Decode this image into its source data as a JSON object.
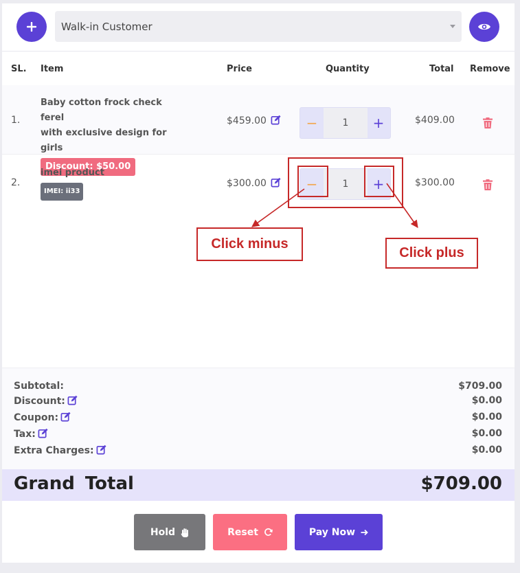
{
  "customer": {
    "selected": "Walk-in Customer",
    "add_icon": "plus-icon",
    "view_icon": "eye-icon"
  },
  "table": {
    "headers": {
      "sl": "SL.",
      "item": "Item",
      "price": "Price",
      "quantity": "Quantity",
      "total": "Total",
      "remove": "Remove"
    },
    "rows": [
      {
        "sl": "1.",
        "name_line1": "Baby cotton frock check ferel",
        "name_line2": "with exclusive design for girls",
        "badge": "Discount: $50.00",
        "price": "$459.00",
        "qty_minus": "−",
        "qty": "1",
        "qty_plus": "+",
        "total": "$409.00"
      },
      {
        "sl": "2.",
        "name_line1": "imei product",
        "badge": "IMEI: ii33",
        "price": "$300.00",
        "qty_minus": "−",
        "qty": "1",
        "qty_plus": "+",
        "total": "$300.00"
      }
    ]
  },
  "annotations": {
    "minus_label": "Click minus",
    "plus_label": "Click plus"
  },
  "totals": {
    "subtotal_label": "Subtotal:",
    "subtotal_value": "$709.00",
    "discount_label": "Discount:",
    "discount_value": "$0.00",
    "coupon_label": "Coupon:",
    "coupon_value": "$0.00",
    "tax_label": "Tax:",
    "tax_value": "$0.00",
    "extra_label": "Extra Charges:",
    "extra_value": "$0.00"
  },
  "grand_total": {
    "label": "Grand Total",
    "value": "$709.00"
  },
  "actions": {
    "hold": "Hold",
    "reset": "Reset",
    "pay": "Pay Now"
  },
  "colors": {
    "accent": "#5b41d6",
    "danger": "#f06b7f",
    "annotation": "#c62828"
  }
}
